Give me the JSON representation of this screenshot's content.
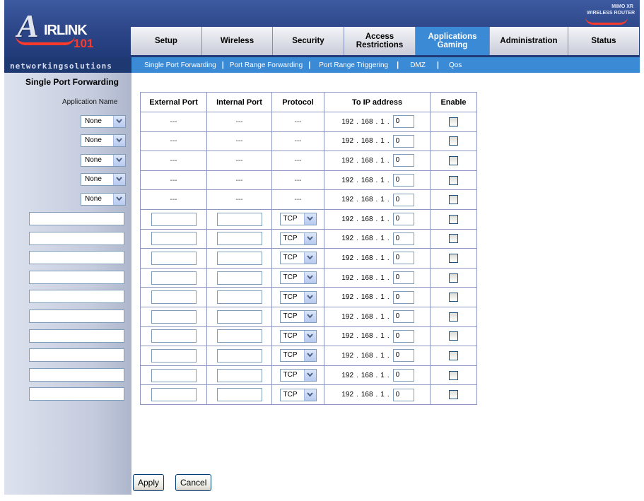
{
  "brand": {
    "logo_initial": "A",
    "logo_word": "IRLINK",
    "logo_number": "101",
    "tagline_prefix": "networking",
    "tagline_suffix": "solutions",
    "badge_line1": "MIMO XR",
    "badge_line2": "WIRELESS ROUTER",
    "accent_color": "#ff3a2b"
  },
  "tabs": [
    {
      "label": "Setup",
      "active": false
    },
    {
      "label": "Wireless",
      "active": false
    },
    {
      "label": "Security",
      "active": false
    },
    {
      "label": "Access Restrictions",
      "active": false
    },
    {
      "label": "Applications Gaming",
      "active": true
    },
    {
      "label": "Administration",
      "active": false
    },
    {
      "label": "Status",
      "active": false
    }
  ],
  "subnav": [
    "Single Port Forwarding",
    "Port Range Forwarding",
    "Port Range Triggering",
    "DMZ",
    "Qos"
  ],
  "page": {
    "heading": "Single Port Forwarding",
    "app_name_label": "Application Name"
  },
  "table": {
    "headers": [
      "External Port",
      "Internal Port",
      "Protocol",
      "To IP address",
      "Enable"
    ],
    "ip_prefix": [
      "192",
      "168",
      "1"
    ],
    "ip_last_default": "0",
    "preset_app_value": "None",
    "preset_placeholder": "---",
    "protocol_default": "TCP",
    "preset_rows": 5,
    "custom_rows": 10
  },
  "buttons": {
    "apply": "Apply",
    "cancel": "Cancel"
  }
}
